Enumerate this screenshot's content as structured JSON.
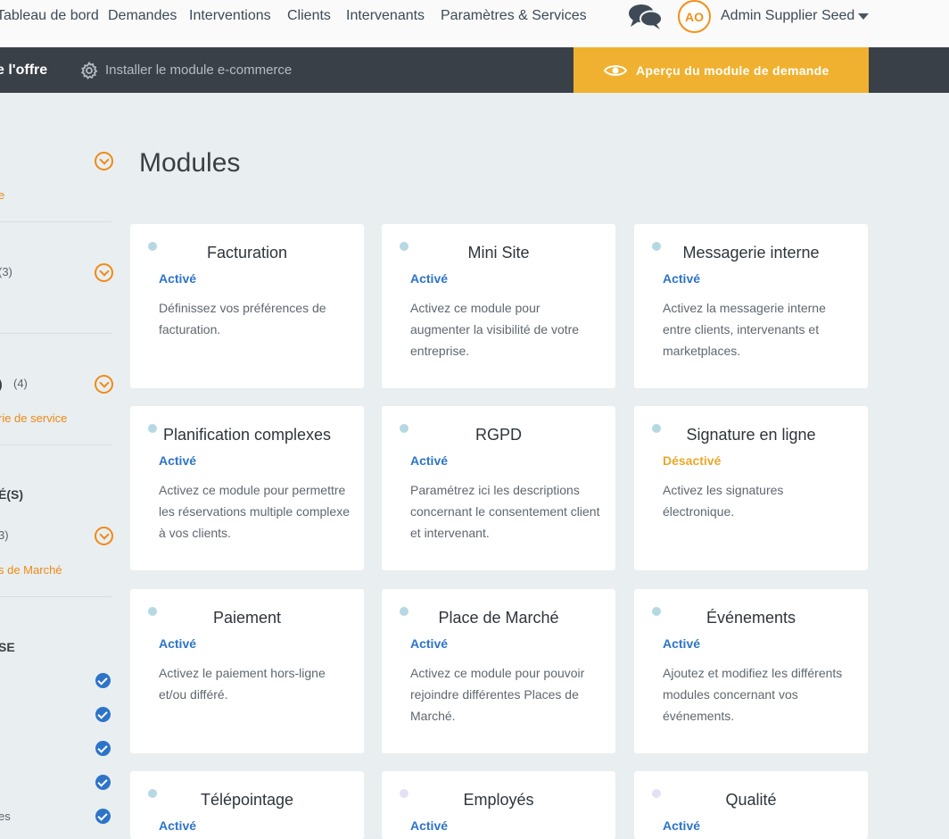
{
  "nav": {
    "links": [
      "Tableau de bord",
      "Demandes",
      "Interventions",
      "Clients",
      "Intervenants",
      "Paramètres & Services"
    ],
    "user": {
      "initials": "AO",
      "name": "Admin Supplier Seed"
    }
  },
  "toolbar": {
    "offer_label": "e l'offre",
    "install_label": "Installer le module e-commerce",
    "preview_label": "Aperçu du module de demande"
  },
  "sidebar": {
    "items": [
      {
        "text": "e"
      },
      {
        "text": "(3)"
      },
      {
        "text": ")"
      },
      {
        "text": "(4)"
      },
      {
        "text": "rie de service"
      },
      {
        "text": "É(S)"
      },
      {
        "text": "3)"
      },
      {
        "text": "s de Marché"
      },
      {
        "text": "SE"
      },
      {
        "text": "es"
      }
    ]
  },
  "main": {
    "title": "Modules",
    "cards": [
      {
        "title": "Facturation",
        "status": "Activé",
        "desc": "Définissez vos préférences de facturation."
      },
      {
        "title": "Mini Site",
        "status": "Activé",
        "desc": "Activez ce module pour augmenter la visibilité de votre entreprise."
      },
      {
        "title": "Messagerie interne",
        "status": "Activé",
        "desc": "Activez la messagerie interne entre clients, intervenants et marketplaces."
      },
      {
        "title": "Planification complexes",
        "status": "Activé",
        "desc": "Activez ce module pour permettre les réservations multiple complexe à vos clients."
      },
      {
        "title": "RGPD",
        "status": "Activé",
        "desc": "Paramétrez ici les descriptions concernant le consentement client et intervenant."
      },
      {
        "title": "Signature en ligne",
        "status": "Désactivé",
        "desc": "Activez les signatures électronique."
      },
      {
        "title": "Paiement",
        "status": "Activé",
        "desc": "Activez le paiement hors-ligne et/ou différé."
      },
      {
        "title": "Place de Marché",
        "status": "Activé",
        "desc": "Activez ce module pour pouvoir rejoindre différentes Places de Marché."
      },
      {
        "title": "Événements",
        "status": "Activé",
        "desc": "Ajoutez et modifiez les différents modules concernant vos événements."
      },
      {
        "title": "Télépointage",
        "status": "Activé",
        "desc": ""
      },
      {
        "title": "Employés",
        "status": "Activé",
        "desc": ""
      },
      {
        "title": "Qualité",
        "status": "Activé",
        "desc": ""
      }
    ]
  },
  "colors": {
    "accent_orange": "#ef8a17",
    "preview_button": "#efb12f",
    "status_active": "#2d74c9",
    "status_inactive": "#eaa72b",
    "toolbar_bg": "#3a4048"
  }
}
